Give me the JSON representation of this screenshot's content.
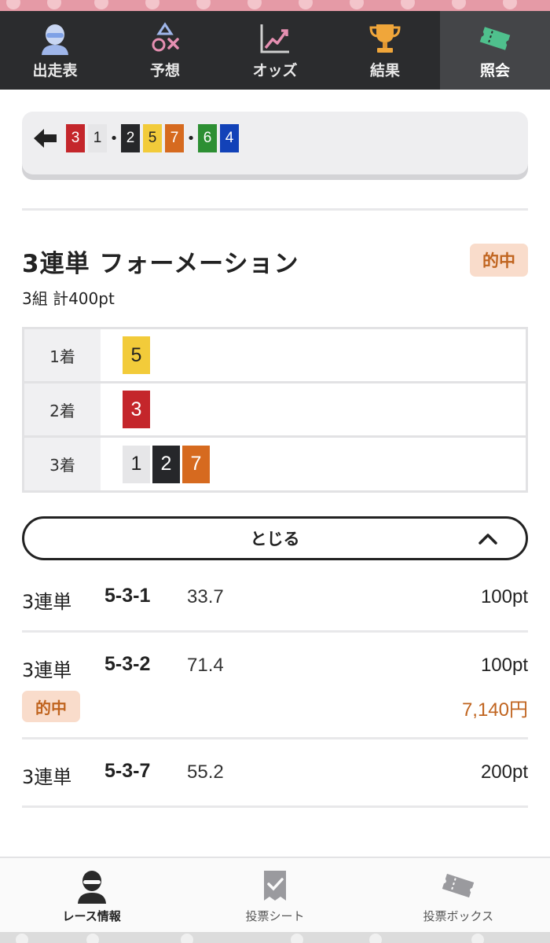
{
  "top_nav": {
    "tabs": [
      {
        "label": "出走表",
        "icon": "racer-icon",
        "active": false
      },
      {
        "label": "予想",
        "icon": "prediction-icon",
        "active": false
      },
      {
        "label": "オッズ",
        "icon": "odds-chart-icon",
        "active": false
      },
      {
        "label": "結果",
        "icon": "trophy-icon",
        "active": false
      },
      {
        "label": "照会",
        "icon": "ticket-icon",
        "active": true
      }
    ]
  },
  "bet_summary": {
    "groups": [
      [
        "3",
        "1"
      ],
      [
        "2",
        "5",
        "7"
      ],
      [
        "6",
        "4"
      ]
    ],
    "separator": "•"
  },
  "bet_detail": {
    "title": "3連単 フォーメーション",
    "hit_label": "的中",
    "subtitle": "3組 計400pt",
    "rows": [
      {
        "position": "1着",
        "numbers": [
          "5"
        ]
      },
      {
        "position": "2着",
        "numbers": [
          "3"
        ]
      },
      {
        "position": "3着",
        "numbers": [
          "1",
          "2",
          "7"
        ]
      }
    ]
  },
  "close_button": {
    "label": "とじる"
  },
  "tickets": [
    {
      "type": "3連単",
      "combo": "5-3-1",
      "odds": "33.7",
      "amount": "100pt",
      "hit": false,
      "hit_label": "",
      "payout": ""
    },
    {
      "type": "3連単",
      "combo": "5-3-2",
      "odds": "71.4",
      "amount": "100pt",
      "hit": true,
      "hit_label": "的中",
      "payout": "7,140円"
    },
    {
      "type": "3連単",
      "combo": "5-3-7",
      "odds": "55.2",
      "amount": "200pt",
      "hit": false,
      "hit_label": "",
      "payout": ""
    }
  ],
  "bottom_nav": {
    "tabs": [
      {
        "label": "レース情報",
        "icon": "racer-icon",
        "active": true
      },
      {
        "label": "投票シート",
        "icon": "vote-sheet-icon",
        "active": false
      },
      {
        "label": "投票ボックス",
        "icon": "vote-box-ticket-icon",
        "active": false
      }
    ]
  },
  "colors": {
    "nav_bg": "#2b2c2e",
    "hit_text": "#c0641f",
    "hit_bg": "#f9dccb",
    "boat_1": "#e6e6e8",
    "boat_2": "#26272a",
    "boat_3": "#c4262b",
    "boat_4": "#1242b8",
    "boat_5": "#f2cb3a",
    "boat_6": "#2d8f33",
    "boat_7": "#d66a1f"
  }
}
